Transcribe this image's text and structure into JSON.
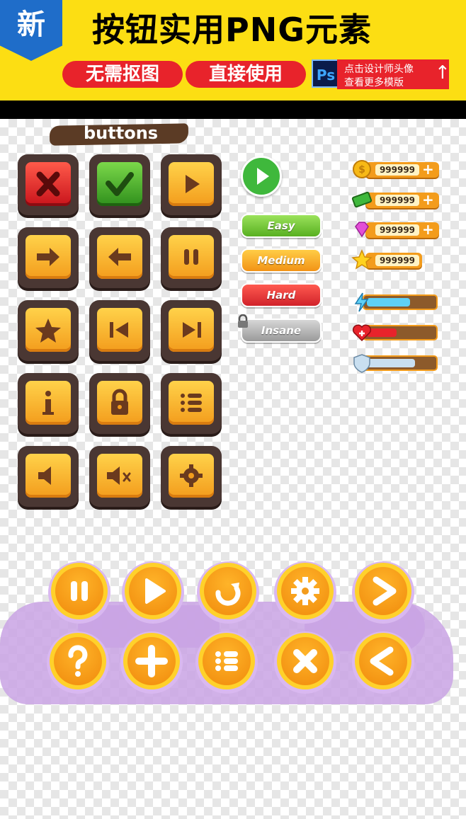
{
  "banner": {
    "new_tag": "新",
    "title": "按钮实用PNG元素",
    "pill_left": "无需抠图",
    "pill_right": "直接使用",
    "ps_icon_label": "Ps",
    "promo_line1": "点击设计师头像",
    "promo_line2": "查看更多模版",
    "promo_arrow": "↑"
  },
  "section_label": "buttons",
  "square_buttons": [
    {
      "icon": "close-icon",
      "style": "red"
    },
    {
      "icon": "check-icon",
      "style": "green"
    },
    {
      "icon": "play-icon",
      "style": "orange"
    },
    {
      "icon": "arrow-right-icon",
      "style": "orange"
    },
    {
      "icon": "arrow-left-icon",
      "style": "orange"
    },
    {
      "icon": "pause-icon",
      "style": "orange"
    },
    {
      "icon": "star-icon",
      "style": "orange"
    },
    {
      "icon": "skip-back-icon",
      "style": "orange"
    },
    {
      "icon": "skip-forward-icon",
      "style": "orange"
    },
    {
      "icon": "info-icon",
      "style": "orange"
    },
    {
      "icon": "lock-icon",
      "style": "orange"
    },
    {
      "icon": "list-icon",
      "style": "orange"
    },
    {
      "icon": "sound-icon",
      "style": "orange"
    },
    {
      "icon": "mute-icon",
      "style": "orange"
    },
    {
      "icon": "gear-icon",
      "style": "orange"
    }
  ],
  "difficulty": {
    "easy": "Easy",
    "medium": "Medium",
    "hard": "Hard",
    "insane": "Insane"
  },
  "resources": [
    {
      "icon": "coin-icon",
      "value": "999999",
      "has_plus": true
    },
    {
      "icon": "cash-icon",
      "value": "999999",
      "has_plus": true
    },
    {
      "icon": "gem-icon",
      "value": "999999",
      "has_plus": true
    },
    {
      "icon": "star-icon",
      "value": "999999",
      "has_plus": false
    }
  ],
  "resource_plus": "+",
  "meters": [
    {
      "icon": "lightning-icon",
      "fill_fraction": 0.65,
      "color": "#5fd0f5"
    },
    {
      "icon": "heart-icon",
      "fill_fraction": 0.45,
      "color": "#e8232b"
    },
    {
      "icon": "shield-icon",
      "fill_fraction": 0.72,
      "color": "#c9dff0"
    }
  ],
  "round_buttons": [
    "pause-icon",
    "play-icon",
    "redo-icon",
    "gear-icon",
    "chevron-right-icon",
    "question-icon",
    "plus-icon",
    "list-icon",
    "close-icon",
    "chevron-left-icon"
  ],
  "colors": {
    "banner_yellow": "#fcde13",
    "accent_red": "#e8232b",
    "new_blue": "#1f6dc9",
    "button_orange": "#f39c1c",
    "frame_brown": "#4a3733",
    "purple_splash": "#c9a3e4"
  }
}
